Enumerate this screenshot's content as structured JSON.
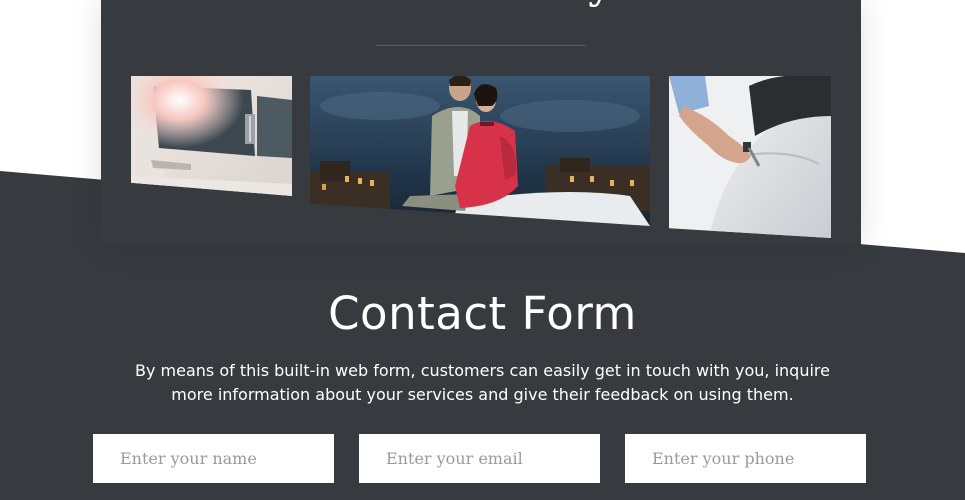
{
  "gallery": {
    "title": "Our Gallery",
    "photos": [
      {
        "name": "white limousine side view"
      },
      {
        "name": "couple in evening wear"
      },
      {
        "name": "hand opening car door"
      }
    ]
  },
  "contact": {
    "title": "Contact Form",
    "description": "By means of this built-in web form, customers can easily get in touch with you, inquire more information about your services and give their feedback on using them.",
    "fields": {
      "name_placeholder": "Enter your name",
      "email_placeholder": "Enter your email",
      "phone_placeholder": "Enter your phone"
    }
  },
  "colors": {
    "dark_bg": "#373b3f",
    "text": "#ffffff",
    "field_bg": "#ffffff",
    "placeholder": "#9a9a9a"
  }
}
